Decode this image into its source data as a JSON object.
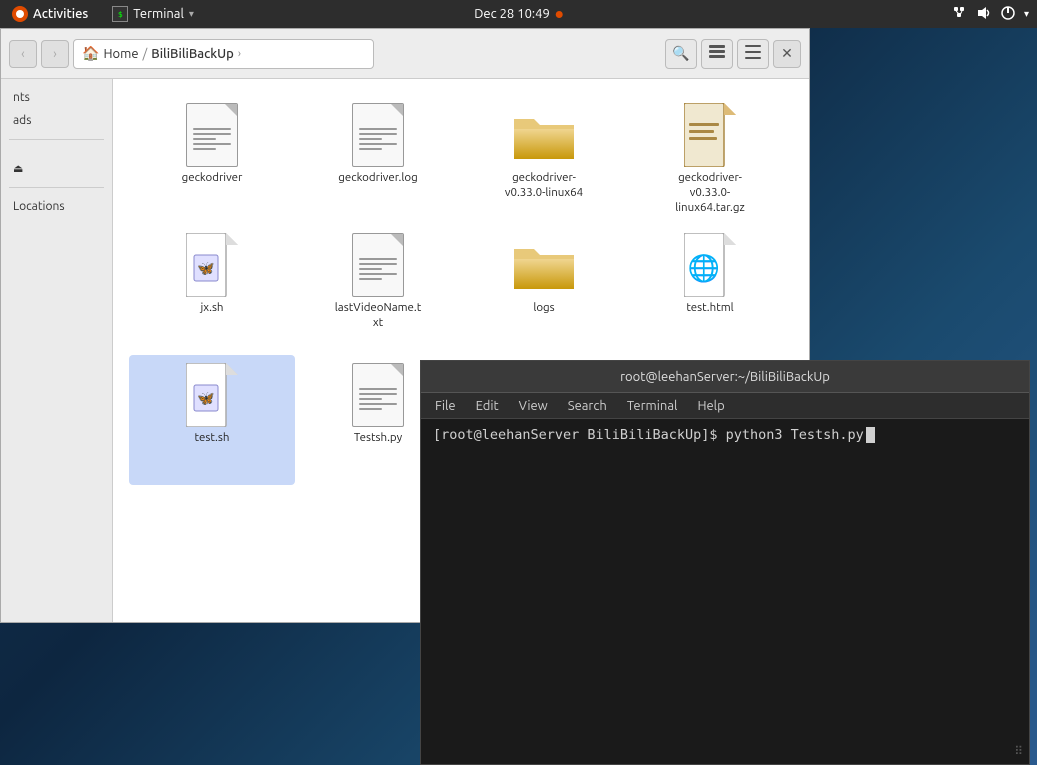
{
  "topbar": {
    "activities_label": "Activities",
    "activities_icon": "●",
    "terminal_label": "Terminal",
    "terminal_arrow": "▾",
    "datetime": "Dec 28  10:49",
    "dot": "●",
    "icons": {
      "network": "⬡",
      "sound": "🔊",
      "power": "⏻",
      "arrow": "▾"
    }
  },
  "file_manager": {
    "toolbar": {
      "back_label": "‹",
      "forward_label": "›",
      "home_label": "Home",
      "breadcrumb_sep": "/",
      "current_folder": "BiliBiliBackUp",
      "forward_arrow": "›",
      "search_icon": "🔍",
      "list_icon": "☰",
      "menu_icon": "≡",
      "close_icon": "✕"
    },
    "sidebar": {
      "items": [
        {
          "label": "nts",
          "type": "item"
        },
        {
          "label": "ads",
          "type": "item"
        },
        {
          "type": "divider"
        },
        {
          "label": "",
          "type": "item"
        },
        {
          "label": "eject",
          "type": "eject"
        },
        {
          "type": "divider"
        },
        {
          "label": "Locations",
          "type": "item"
        }
      ]
    },
    "files": [
      {
        "name": "geckodriver",
        "type": "document"
      },
      {
        "name": "geckodriver.log",
        "type": "document"
      },
      {
        "name": "geckodriver-v0.33.0-linux64",
        "type": "folder"
      },
      {
        "name": "geckodriver-v0.33.0-linux64.tar.gz",
        "type": "document_tar"
      },
      {
        "name": "jx.sh",
        "type": "shell"
      },
      {
        "name": "lastVideoName.txt",
        "type": "document"
      },
      {
        "name": "logs",
        "type": "folder"
      },
      {
        "name": "test.html",
        "type": "html"
      },
      {
        "name": "test.sh",
        "type": "shell",
        "selected": true
      },
      {
        "name": "Testsh.py",
        "type": "document"
      }
    ]
  },
  "terminal": {
    "title": "root@leehanServer:~/BiliBiliBackUp",
    "menu": {
      "file": "File",
      "edit": "Edit",
      "view": "View",
      "search": "Search",
      "terminal": "Terminal",
      "help": "Help"
    },
    "prompt": "[root@leehanServer BiliBiliBackUp]$ python3 Testsh.py "
  }
}
